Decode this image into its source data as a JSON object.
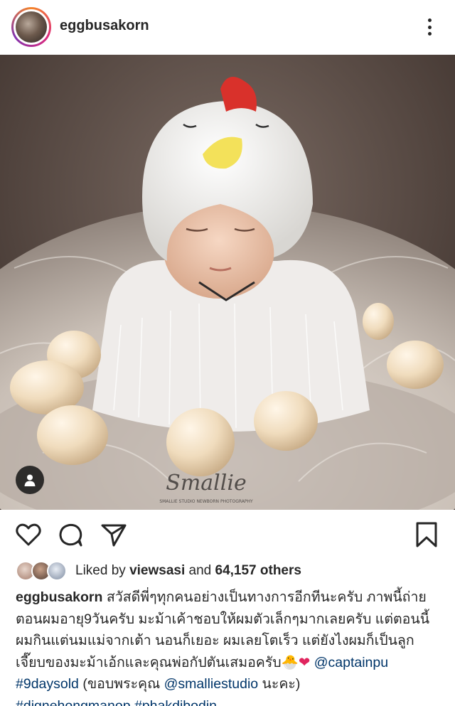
{
  "header": {
    "username": "eggbusakorn"
  },
  "photo": {
    "watermark_script": "Smallie",
    "watermark_sub": "SMALLIE STUDIO NEWBORN PHOTOGRAPHY"
  },
  "likes": {
    "prefix": "Liked by",
    "user": "viewsasi",
    "middle": "and",
    "count": "64,157 others"
  },
  "caption": {
    "author": "eggbusakorn",
    "line1": "สวัสดีพี่ๆทุกคนอย่างเป็นทางการอีกทีนะครับ ภาพนี้ถ่าย",
    "line2": "ตอนผมอายุ9วันครับ มะม้าเค้าชอบให้ผมตัวเล็กๆมากเลยครับ แต่ตอนนี้",
    "line3": "ผมกินแต่นมแม่จากเต้า นอนก็เยอะ ผมเลยโตเร็ว แต่ยังไงผมก็เป็นลูก",
    "line4": "เจี๊ยบของมะม้าเอ้กและคุณพ่อกัปตันเสมอครับ",
    "chick_emoji": "🐣",
    "heart_emoji": "❤",
    "mention_captain": "@captainpu",
    "hashtag_9days": "#9daysold",
    "thanks_open": "(ขอบพระคุณ",
    "mention_smallie": "@smalliestudio",
    "thanks_close": "นะคะ)",
    "hashtag_digne": "#dignehongmanop",
    "hashtag_phakdi": "#phakdibodin"
  }
}
